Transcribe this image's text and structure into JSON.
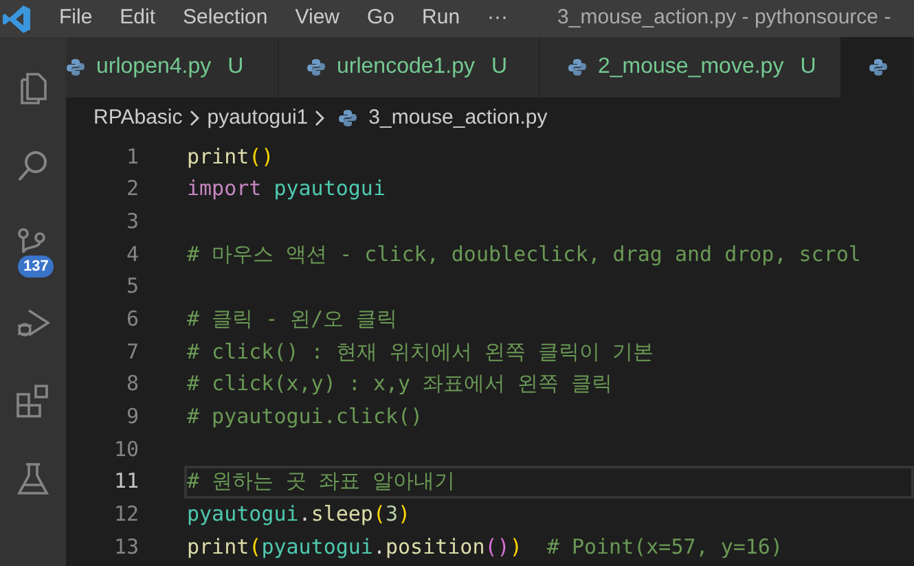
{
  "window": {
    "title": "3_mouse_action.py - pythonsource -"
  },
  "menu": [
    "File",
    "Edit",
    "Selection",
    "View",
    "Go",
    "Run",
    "···"
  ],
  "activity_bar": [
    {
      "kind": "explorer"
    },
    {
      "kind": "search"
    },
    {
      "kind": "source-control",
      "badge": "137"
    },
    {
      "kind": "debug"
    },
    {
      "kind": "extensions"
    },
    {
      "kind": "testing"
    }
  ],
  "tabs": [
    {
      "label": "urlopen4.py",
      "status": "U",
      "selected": false
    },
    {
      "label": "urlencode1.py",
      "status": "U",
      "selected": false
    },
    {
      "label": "2_mouse_move.py",
      "status": "U",
      "selected": false
    },
    {
      "selected": true
    }
  ],
  "breadcrumbs": [
    {
      "label": "RPAbasic"
    },
    {
      "label": "pyautogui1"
    },
    {
      "label": "3_mouse_action.py",
      "file": true
    }
  ],
  "code": [
    {
      "number": "1",
      "current": false,
      "tokens": [
        {
          "kind": "func",
          "text": "print"
        },
        {
          "kind": "paren",
          "text": "()"
        }
      ]
    },
    {
      "number": "2",
      "current": false,
      "tokens": [
        {
          "kind": "keyword",
          "text": "import "
        },
        {
          "kind": "module",
          "text": "pyautogui"
        }
      ]
    },
    {
      "number": "3",
      "current": false
    },
    {
      "number": "4",
      "current": false,
      "tokens": [
        {
          "kind": "comment",
          "text": "# 마우스 액션 - click, doubleclick, drag and drop, scrol"
        }
      ]
    },
    {
      "number": "5",
      "current": false
    },
    {
      "number": "6",
      "current": false,
      "tokens": [
        {
          "kind": "comment",
          "text": "# 클릭 - 왼/오 클릭"
        }
      ]
    },
    {
      "number": "7",
      "current": false,
      "tokens": [
        {
          "kind": "comment",
          "text": "# click() : 현재 위치에서 왼쪽 클릭이 기본"
        }
      ]
    },
    {
      "number": "8",
      "current": false,
      "tokens": [
        {
          "kind": "comment",
          "text": "# click(x,y) : x,y 좌표에서 왼쪽 클릭"
        }
      ]
    },
    {
      "number": "9",
      "current": false,
      "tokens": [
        {
          "kind": "comment",
          "text": "# pyautogui.click()"
        }
      ]
    },
    {
      "number": "10",
      "current": false
    },
    {
      "number": "11",
      "current": true,
      "tokens": [
        {
          "kind": "comment",
          "text": "# 원하는 곳 좌표 알아내기"
        }
      ]
    },
    {
      "number": "12",
      "current": false,
      "tokens": [
        {
          "kind": "module",
          "text": "pyautogui"
        },
        {
          "kind": "plain",
          "text": "."
        },
        {
          "kind": "func",
          "text": "sleep"
        },
        {
          "kind": "paren",
          "text": "("
        },
        {
          "kind": "number",
          "text": "3"
        },
        {
          "kind": "paren",
          "text": ")"
        }
      ]
    },
    {
      "number": "13",
      "current": false,
      "tokens": [
        {
          "kind": "func",
          "text": "print"
        },
        {
          "kind": "paren",
          "text": "("
        },
        {
          "kind": "module",
          "text": "pyautogui"
        },
        {
          "kind": "plain",
          "text": "."
        },
        {
          "kind": "func",
          "text": "position"
        },
        {
          "kind": "paren2",
          "text": "()"
        },
        {
          "kind": "paren",
          "text": ")"
        },
        {
          "kind": "comment",
          "text": "  # Point(x=57, y=16)"
        }
      ]
    }
  ]
}
